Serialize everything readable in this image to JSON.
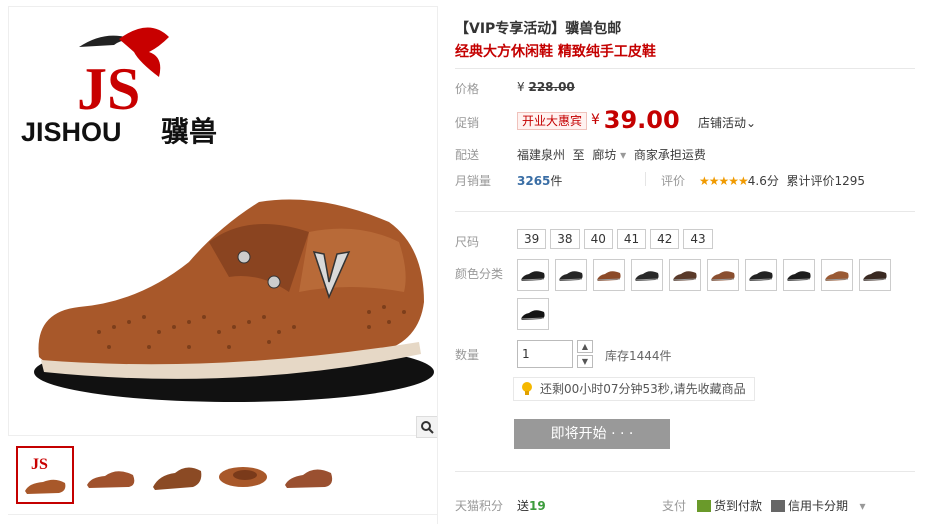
{
  "brand": {
    "logo_letters": "JS",
    "logo_name": "JISHOU",
    "logo_cn": "骥兽"
  },
  "product": {
    "title_line1": "【VIP专享活动】骥兽包邮",
    "title_line2": "经典大方休闲鞋 精致纯手工皮鞋"
  },
  "price": {
    "label": "价格",
    "currency": "¥",
    "original": "228.00"
  },
  "promo": {
    "label": "促销",
    "badge": "开业大惠宾",
    "currency": "¥",
    "price": "39.00",
    "shop_event": "店铺活动"
  },
  "delivery": {
    "label": "配送",
    "from": "福建泉州",
    "to_word": "至",
    "dest": "廊坊",
    "fee": "商家承担运费"
  },
  "sales": {
    "label": "月销量",
    "count": "3265",
    "unit": "件",
    "rating_label": "评价",
    "stars": "★★★★★",
    "score": "4.6分",
    "reviews": "累计评价1295"
  },
  "size": {
    "label": "尺码",
    "options": [
      "39",
      "38",
      "40",
      "41",
      "42",
      "43"
    ]
  },
  "color": {
    "label": "颜色分类",
    "swatches": [
      "#1e1e1e",
      "#262626",
      "#8c4a28",
      "#2a2a2a",
      "#5a3a2a",
      "#8a4f30",
      "#232323",
      "#1c1c1c",
      "#9a5a34",
      "#3a2a22",
      "#141414"
    ]
  },
  "quantity": {
    "label": "数量",
    "value": "1",
    "stock": "库存1444件"
  },
  "notice": {
    "text": "还剩00小时07分钟53秒,请先收藏商品"
  },
  "button": {
    "start": "即将开始 · · ·"
  },
  "footer": {
    "score_label": "天猫积分",
    "score_prefix": "送",
    "score_value": "19",
    "pay_label": "支付",
    "pay1": "货到付款",
    "pay2": "信用卡分期"
  },
  "colors": {
    "accent": "#c40000",
    "link": "#3a6ea5",
    "shoe": "#a8582a"
  }
}
